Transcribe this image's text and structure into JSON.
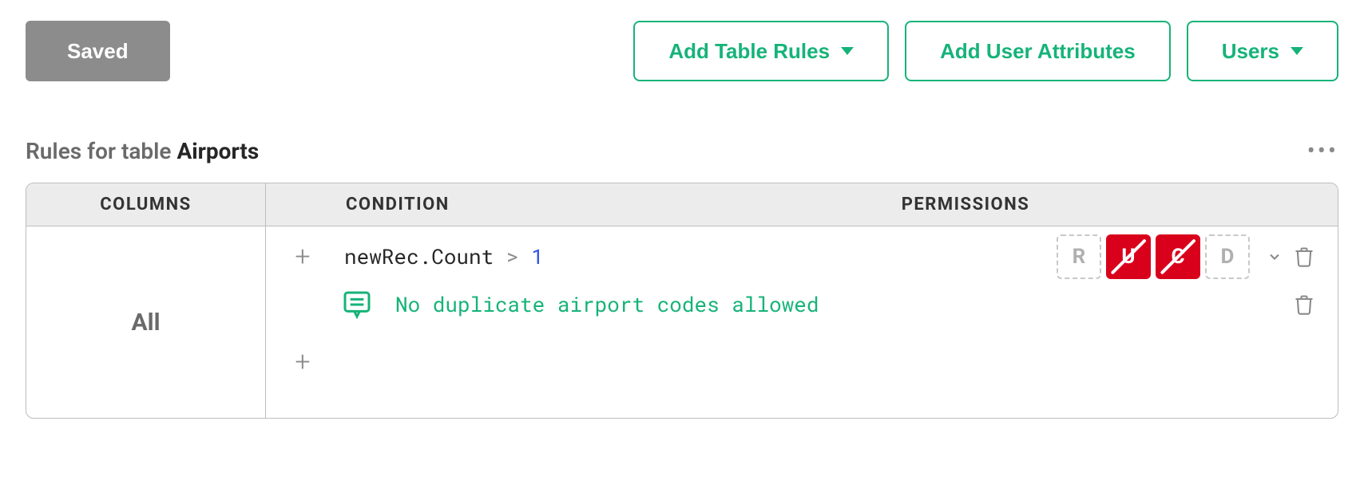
{
  "toolbar": {
    "saved_label": "Saved",
    "add_table_rules_label": "Add Table Rules",
    "add_user_attributes_label": "Add User Attributes",
    "users_label": "Users"
  },
  "section": {
    "title_prefix": "Rules for table ",
    "title_table": "Airports"
  },
  "table": {
    "headers": {
      "columns": "COLUMNS",
      "condition": "CONDITION",
      "permissions": "PERMISSIONS"
    },
    "row": {
      "columns_label": "All",
      "rules": [
        {
          "condition_var": "newRec.Count",
          "condition_op": ">",
          "condition_val": "1",
          "permissions": {
            "R": "unset",
            "U": "deny",
            "C": "deny",
            "D": "unset"
          },
          "memo": "No duplicate airport codes allowed"
        }
      ]
    }
  },
  "perm_labels": {
    "R": "R",
    "U": "U",
    "C": "C",
    "D": "D"
  }
}
